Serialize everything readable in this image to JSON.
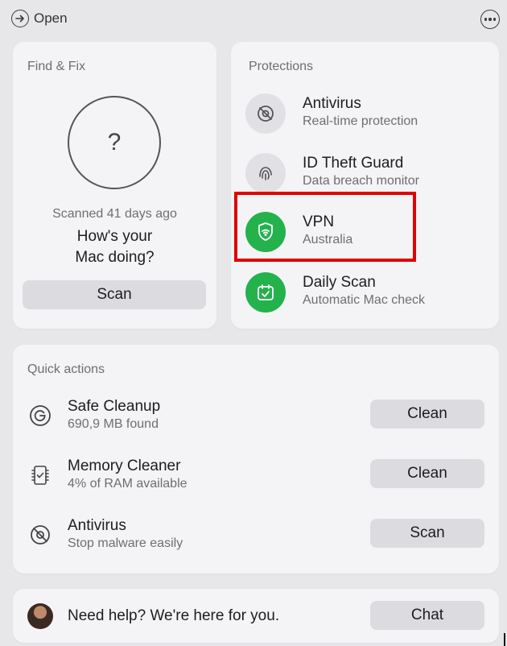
{
  "topbar": {
    "open_label": "Open"
  },
  "find_fix": {
    "title": "Find & Fix",
    "ring_symbol": "?",
    "scanned": "Scanned 41 days ago",
    "question_line1": "How's your",
    "question_line2": "Mac doing?",
    "scan_label": "Scan"
  },
  "protections": {
    "title": "Protections",
    "items": [
      {
        "name": "Antivirus",
        "sub": "Real-time protection",
        "icon": "antivirus-icon",
        "status": "off"
      },
      {
        "name": "ID Theft Guard",
        "sub": "Data breach monitor",
        "icon": "fingerprint-icon",
        "status": "off"
      },
      {
        "name": "VPN",
        "sub": "Australia",
        "icon": "vpn-shield-icon",
        "status": "on"
      },
      {
        "name": "Daily Scan",
        "sub": "Automatic Mac check",
        "icon": "calendar-check-icon",
        "status": "on"
      }
    ]
  },
  "quick_actions": {
    "title": "Quick actions",
    "items": [
      {
        "name": "Safe Cleanup",
        "sub": "690,9 MB found",
        "button": "Clean",
        "icon": "cleanup-icon"
      },
      {
        "name": "Memory Cleaner",
        "sub": "4% of RAM available",
        "button": "Clean",
        "icon": "memory-icon"
      },
      {
        "name": "Antivirus",
        "sub": "Stop malware easily",
        "button": "Scan",
        "icon": "antivirus-icon"
      }
    ]
  },
  "help": {
    "text": "Need help? We're here for you.",
    "button": "Chat"
  },
  "colors": {
    "green": "#23b24c",
    "highlight": "#e00000"
  }
}
